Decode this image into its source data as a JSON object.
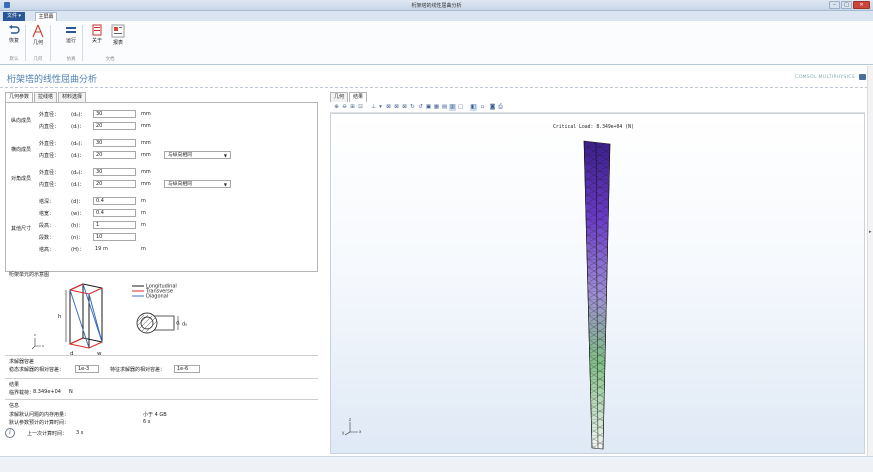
{
  "window": {
    "title": "桁架塔的线性屈曲分析"
  },
  "ribbon": {
    "tabs": [
      "文件 ▾",
      "主屏幕"
    ],
    "buttons": [
      {
        "label": "恢复",
        "icon": "undo-icon"
      },
      {
        "label": "几何",
        "icon": "geometry-icon"
      },
      {
        "label": "运行",
        "icon": "run-icon"
      },
      {
        "label": "关于",
        "icon": "about-icon"
      },
      {
        "label": "报表",
        "icon": "report-icon"
      }
    ],
    "groups": [
      "默认",
      "几何",
      "仿真",
      "文档"
    ]
  },
  "app": {
    "title": "桁架塔的线性屈曲分析",
    "logo": "COMSOL MULTIPHYSICS"
  },
  "left_tabs": [
    "几何参数",
    "拉线塔",
    "材料选择"
  ],
  "params": {
    "longitudinal": {
      "group": "纵向成员",
      "outer": {
        "label": "外直径：",
        "sym": "(d₀)：",
        "value": "30",
        "unit": "mm"
      },
      "inner": {
        "label": "内直径：",
        "sym": "(dᵢ)：",
        "value": "20",
        "unit": "mm"
      }
    },
    "transverse": {
      "group": "横向成员",
      "outer": {
        "label": "外直径：",
        "sym": "(d₀)：",
        "value": "30",
        "unit": "mm"
      },
      "inner": {
        "label": "内直径：",
        "sym": "(dᵢ)：",
        "value": "20",
        "unit": "mm"
      },
      "select": "与纵向相同"
    },
    "diagonal": {
      "group": "对角成员",
      "outer": {
        "label": "外直径：",
        "sym": "(d₀)：",
        "value": "30",
        "unit": "mm"
      },
      "inner": {
        "label": "内直径：",
        "sym": "(dᵢ)：",
        "value": "20",
        "unit": "mm"
      },
      "select": "与纵向相同"
    },
    "other": {
      "group": "其他尺寸",
      "rows": [
        {
          "label": "塔深：",
          "sym": "(d)：",
          "value": "0.4",
          "unit": "m"
        },
        {
          "label": "塔宽：",
          "sym": "(w)：",
          "value": "0.4",
          "unit": "m"
        },
        {
          "label": "段高：",
          "sym": "(h)：",
          "value": "1",
          "unit": "m"
        },
        {
          "label": "段数：",
          "sym": "(n)：",
          "value": "10",
          "unit": ""
        },
        {
          "label": "塔高：",
          "sym": "(H)：",
          "value": "19 m",
          "unit": "m"
        }
      ]
    }
  },
  "schematic": {
    "title": "桁架单元的示意图",
    "legend": [
      {
        "label": "Longitudinal",
        "color": "#1a1a1a"
      },
      {
        "label": "Transverse",
        "color": "#e0261f"
      },
      {
        "label": "Diagonal",
        "color": "#3d6fc0"
      }
    ],
    "labels": {
      "h": "h",
      "d": "d",
      "w": "w",
      "di": "dᵢ",
      "do": "d₀"
    }
  },
  "solver": {
    "title": "求解器容差",
    "stab_label": "稳态求解器的相对容差：",
    "stab_value": "1e-3",
    "eig_label": "特征求解器的相对容差：",
    "eig_value": "1e-6"
  },
  "results": {
    "title": "结果",
    "label": "临界载荷：",
    "value": "8.349e+04",
    "unit": "N"
  },
  "info": {
    "title": "信息",
    "mem_label": "求解默认问题的内存用量：",
    "mem_value": "小于 4 GB",
    "time_label": "默认参数预计的计算时间：",
    "time_value": "6 s",
    "last_label": "上一次计算时间：",
    "last_value": "3 s"
  },
  "graphics": {
    "tabs": [
      "几何",
      "结果"
    ],
    "caption": "Critical Load: 8.349e+04 (N)"
  }
}
